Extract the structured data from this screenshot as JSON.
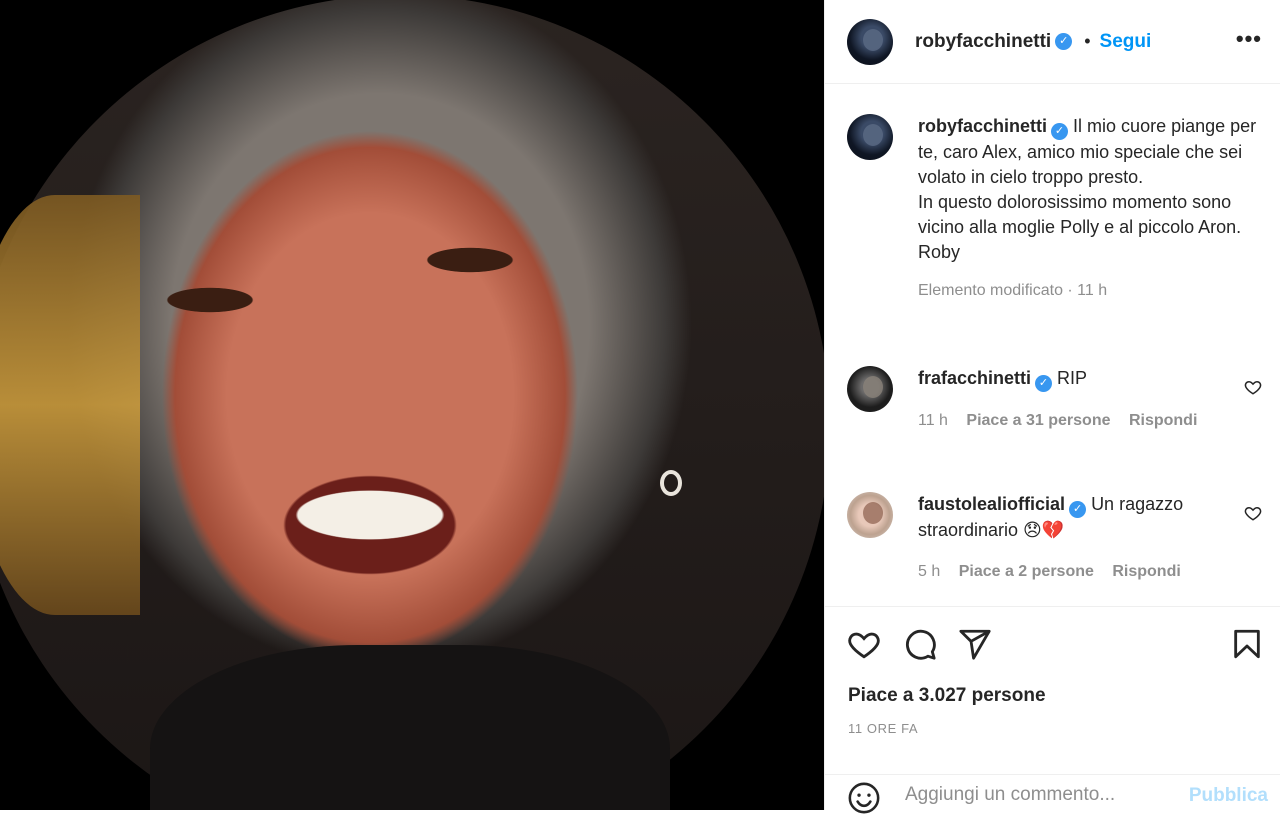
{
  "post": {
    "author": "robyfacchinetti",
    "follow_label": "Segui",
    "separator": "•",
    "caption": "Il mio cuore piange per te, caro Alex, amico mio speciale che sei volato in cielo troppo presto.\nIn questo dolorosissimo momento sono vicino alla moglie Polly e al piccolo Aron.\nRoby",
    "caption_meta": "Elemento modificato · 11 h",
    "verified_icon": "✓"
  },
  "comments": [
    {
      "username": "frafacchinetti",
      "text": "RIP",
      "time": "11 h",
      "likes": "Piace a 31 persone",
      "reply": "Rispondi"
    },
    {
      "username": "faustolealiofficial",
      "text": "Un ragazzo straordinario 😞💔",
      "time": "5 h",
      "likes": "Piace a 2 persone",
      "reply": "Rispondi"
    }
  ],
  "footer": {
    "likes": "Piace a 3.027 persone",
    "time_ago": "11 ORE FA",
    "comment_placeholder": "Aggiungi un commento...",
    "publish_label": "Pubblica"
  },
  "icons": [
    "more-options-icon",
    "verified-icon",
    "heart-icon",
    "comment-icon",
    "share-icon",
    "bookmark-icon",
    "emoji-icon"
  ],
  "colors": {
    "accent": "#0095f6",
    "verified": "#3897f0",
    "muted": "#8e8e8e",
    "publish_disabled": "#b2dffc"
  }
}
